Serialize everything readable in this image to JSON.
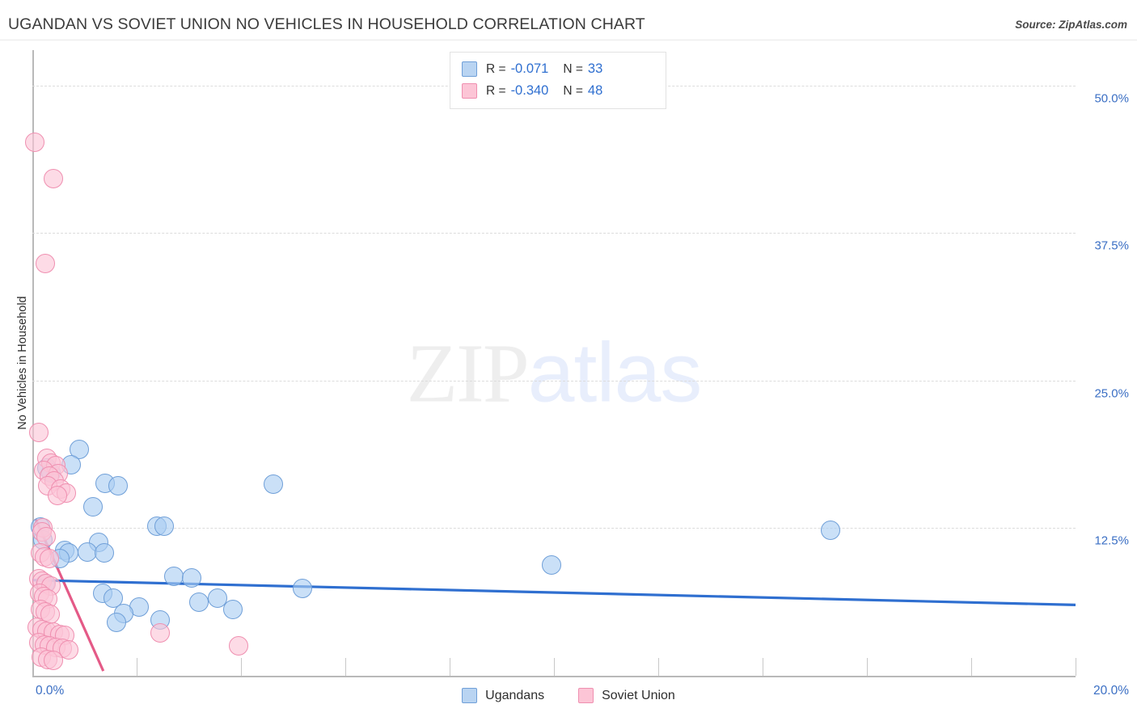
{
  "header": {
    "title": "UGANDAN VS SOVIET UNION NO VEHICLES IN HOUSEHOLD CORRELATION CHART",
    "source": "Source: ZipAtlas.com"
  },
  "watermark": {
    "part1": "ZIP",
    "part2": "atlas"
  },
  "stats": {
    "rows": [
      {
        "series": "Ugandans",
        "r_label": "R =",
        "r_value": "-0.071",
        "n_label": "N =",
        "n_value": "33",
        "color": "#b9d4f2"
      },
      {
        "series": "Soviet Union",
        "r_label": "R =",
        "r_value": "-0.340",
        "n_label": "N =",
        "n_value": "48",
        "color": "#fcc5d6"
      }
    ]
  },
  "legend": {
    "items": [
      {
        "label": "Ugandans",
        "color": "#b9d4f2",
        "border": "#6f9fd8"
      },
      {
        "label": "Soviet Union",
        "color": "#fcc5d6",
        "border": "#ef8fb0"
      }
    ]
  },
  "axes": {
    "y_title": "No Vehicles in Household",
    "y_ticks": [
      "50.0%",
      "37.5%",
      "25.0%",
      "12.5%"
    ],
    "x_left": "0.0%",
    "x_right": "20.0%"
  },
  "chart_data": {
    "type": "scatter",
    "title": "UGANDAN VS SOVIET UNION NO VEHICLES IN HOUSEHOLD CORRELATION CHART",
    "xlabel": "",
    "ylabel": "No Vehicles in Household",
    "xlim": [
      0.0,
      20.0
    ],
    "ylim": [
      0.0,
      53.0
    ],
    "x_unit": "%",
    "y_unit": "%",
    "grid": "horizontal-dashed",
    "legend_position": "bottom-center",
    "y_gridlines": [
      50.0,
      37.5,
      25.0,
      12.5
    ],
    "x_ticks": [
      0.0,
      2.0,
      4.0,
      6.0,
      8.0,
      10.0,
      12.0,
      14.0,
      16.0,
      18.0,
      20.0
    ],
    "series": [
      {
        "name": "Ugandans",
        "color": "#b9d4f2",
        "border": "#6f9fd8",
        "r": -0.071,
        "n": 33,
        "trendline": {
          "x0": 0.0,
          "y0": 8.1,
          "x1": 20.0,
          "y1": 6.0
        },
        "points": [
          [
            0.9,
            19.2
          ],
          [
            0.75,
            17.9
          ],
          [
            0.28,
            17.6
          ],
          [
            0.35,
            17.2
          ],
          [
            1.4,
            16.3
          ],
          [
            1.65,
            16.1
          ],
          [
            4.62,
            16.2
          ],
          [
            1.17,
            14.3
          ],
          [
            2.38,
            12.7
          ],
          [
            2.52,
            12.7
          ],
          [
            15.3,
            12.3
          ],
          [
            0.15,
            12.6
          ],
          [
            0.2,
            11.5
          ],
          [
            1.27,
            11.3
          ],
          [
            0.62,
            10.6
          ],
          [
            0.7,
            10.4
          ],
          [
            1.05,
            10.5
          ],
          [
            1.38,
            10.4
          ],
          [
            0.52,
            9.9
          ],
          [
            9.95,
            9.4
          ],
          [
            2.72,
            8.4
          ],
          [
            3.05,
            8.3
          ],
          [
            0.25,
            7.8
          ],
          [
            5.18,
            7.4
          ],
          [
            1.35,
            7.0
          ],
          [
            1.55,
            6.6
          ],
          [
            3.2,
            6.2
          ],
          [
            3.55,
            6.6
          ],
          [
            2.05,
            5.8
          ],
          [
            3.85,
            5.6
          ],
          [
            1.75,
            5.3
          ],
          [
            2.45,
            4.7
          ],
          [
            1.62,
            4.5
          ]
        ]
      },
      {
        "name": "Soviet Union",
        "color": "#fcc5d6",
        "border": "#ef8fb0",
        "r": -0.34,
        "n": 48,
        "trendline": {
          "x0": 0.06,
          "y0": 13.3,
          "x1": 1.36,
          "y1": 0.4
        },
        "points": [
          [
            0.05,
            45.2
          ],
          [
            0.4,
            42.1
          ],
          [
            0.25,
            34.9
          ],
          [
            0.12,
            20.6
          ],
          [
            0.28,
            18.4
          ],
          [
            0.35,
            18.0
          ],
          [
            0.45,
            17.8
          ],
          [
            0.22,
            17.4
          ],
          [
            0.5,
            17.1
          ],
          [
            0.33,
            16.9
          ],
          [
            0.42,
            16.5
          ],
          [
            0.3,
            16.1
          ],
          [
            0.55,
            15.8
          ],
          [
            0.65,
            15.5
          ],
          [
            0.48,
            15.3
          ],
          [
            0.2,
            12.5
          ],
          [
            0.18,
            12.2
          ],
          [
            0.26,
            11.8
          ],
          [
            0.15,
            10.4
          ],
          [
            0.24,
            10.1
          ],
          [
            0.32,
            9.9
          ],
          [
            0.12,
            8.2
          ],
          [
            0.19,
            8.0
          ],
          [
            0.27,
            7.8
          ],
          [
            0.36,
            7.6
          ],
          [
            0.14,
            7.0
          ],
          [
            0.22,
            6.7
          ],
          [
            0.3,
            6.5
          ],
          [
            0.16,
            5.6
          ],
          [
            0.25,
            5.4
          ],
          [
            0.34,
            5.2
          ],
          [
            0.1,
            4.1
          ],
          [
            0.18,
            3.9
          ],
          [
            0.28,
            3.8
          ],
          [
            0.4,
            3.7
          ],
          [
            0.52,
            3.5
          ],
          [
            0.62,
            3.4
          ],
          [
            0.13,
            2.8
          ],
          [
            0.23,
            2.6
          ],
          [
            0.33,
            2.5
          ],
          [
            0.45,
            2.4
          ],
          [
            0.58,
            2.3
          ],
          [
            0.7,
            2.2
          ],
          [
            0.17,
            1.6
          ],
          [
            0.29,
            1.4
          ],
          [
            0.41,
            1.3
          ],
          [
            2.45,
            3.6
          ],
          [
            3.95,
            2.5
          ]
        ]
      }
    ]
  }
}
